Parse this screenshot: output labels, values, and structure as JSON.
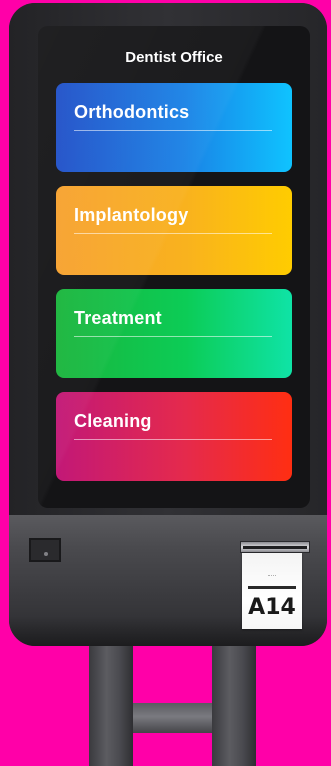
{
  "screen": {
    "title": "Dentist Office"
  },
  "menu": {
    "items": [
      {
        "label": "Orthodontics",
        "color_start": "#1f4fc8",
        "color_end": "#0fc3ff"
      },
      {
        "label": "Implantology",
        "color_start": "#f7a12e",
        "color_end": "#ffcc00"
      },
      {
        "label": "Treatment",
        "color_start": "#1ab53c",
        "color_end": "#0fe3a6"
      },
      {
        "label": "Cleaning",
        "color_start": "#c21877",
        "color_end": "#ff2e12"
      }
    ]
  },
  "ticket": {
    "number": "A14"
  },
  "colors": {
    "background": "#FF00A8",
    "kiosk_body": "#2c2c2f",
    "screen": "#141416"
  },
  "icons": {
    "card_reader": "card-reader-icon"
  }
}
